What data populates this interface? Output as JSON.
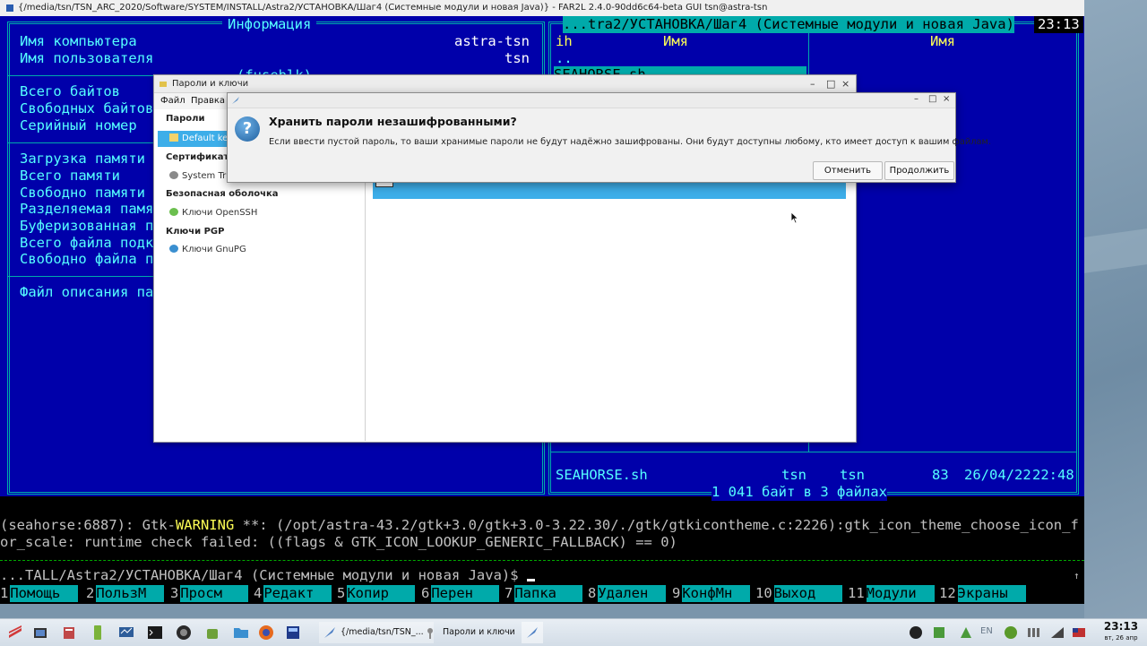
{
  "far": {
    "title": "{/media/tsn/TSN_ARC_2020/Software/SYSTEM/INSTALL/Astra2/УСТАНОВКА/Шаг4 (Системные модули и новая Java)} - FAR2L 2.4.0-90dd6c64-beta GUI tsn@astra-tsn",
    "left_panel": {
      "header": "Информация",
      "computer_label": "Имя компьютера",
      "computer_value": "astra-tsn",
      "user_label": "Имя пользователя",
      "user_value": "tsn",
      "fs_label": "(fuseblk)",
      "rows": [
        "Всего байтов",
        "Свободных байтов",
        "Серийный номер",
        "",
        "Загрузка памяти",
        "Всего памяти",
        "Свободно памяти",
        "Разделяемая памя",
        "Буферизованная п",
        "Всего файла подк",
        "Свободно файла п",
        "",
        "Файл описания па"
      ]
    },
    "right_panel": {
      "header": " ...tra2/УСТАНОВКА/Шаг4 (Системные модули и новая Java) ",
      "clock": "23:13",
      "col1_label": "ih",
      "col2_label": "Имя",
      "col3_label": "Имя",
      "parent": "..",
      "selected_file": "SEAHORSE.sh",
      "status_name": "SEAHORSE.sh",
      "status_user": "tsn",
      "status_group": "tsn",
      "status_size": "83",
      "status_date": "26/04/22",
      "status_time": "22:48",
      "footer": " 1 041 байт в 3 файлах "
    },
    "console": {
      "line1_a": "(seahorse:6887): Gtk-",
      "line1_warn": "WARNING",
      "line1_b": " **: (/opt/astra-43.2/gtk+3.0/gtk+3.0-3.22.30/./gtk/gtkicontheme.c:2226):gtk_icon_theme_choose_icon_f",
      "line2": "or_scale: runtime check failed: ((flags & GTK_ICON_LOOKUP_GENERIC_FALLBACK) == 0)",
      "prompt": "...TALL/Astra2/УСТАНОВКА/Шаг4 (Системные модули и новая Java)$ ",
      "scroll_mark": "↑"
    },
    "fkeys": [
      {
        "n": "1",
        "label": "Помощь"
      },
      {
        "n": "2",
        "label": "ПользМ"
      },
      {
        "n": "3",
        "label": "Просм"
      },
      {
        "n": "4",
        "label": "Редакт"
      },
      {
        "n": "5",
        "label": "Копир"
      },
      {
        "n": "6",
        "label": "Перен"
      },
      {
        "n": "7",
        "label": "Папка"
      },
      {
        "n": "8",
        "label": "Удален"
      },
      {
        "n": "9",
        "label": "КонфМн"
      },
      {
        "n": "10",
        "label": "Выход"
      },
      {
        "n": "11",
        "label": "Модули"
      },
      {
        "n": "12",
        "label": "Экраны"
      }
    ]
  },
  "seahorse": {
    "title": "Пароли и ключи",
    "menu": [
      "Файл",
      "Правка"
    ],
    "sidebar": {
      "passwords_header": "Пароли",
      "default_keyring": "Default key",
      "certs_header": "Сертификаты",
      "system_trust": "System Tru",
      "ssh_header": "Безопасная оболочка",
      "openssh": "Ключи OpenSSH",
      "pgp_header": "Ключи PGP",
      "gnupg": "Ключи GnuPG"
    }
  },
  "dialog": {
    "heading": "Хранить пароли незашифрованными?",
    "message": "Если ввести пустой пароль, то ваши хранимые пароли не будут надёжно зашифрованы. Они будут доступны любому, кто имеет доступ к вашим файлам.",
    "cancel_label": "Отменить",
    "continue_label": "Продолжить"
  },
  "taskbar": {
    "task1": "{/media/tsn/TSN_...",
    "task2": "Пароли и ключи",
    "lang": "EN",
    "time": "23:13",
    "date": "вт, 26 апр"
  },
  "colors": {
    "far_blue": "#0000aa",
    "far_cyan": "#00aaaa",
    "far_text": "#55ffff",
    "selection": "#3daee9"
  }
}
